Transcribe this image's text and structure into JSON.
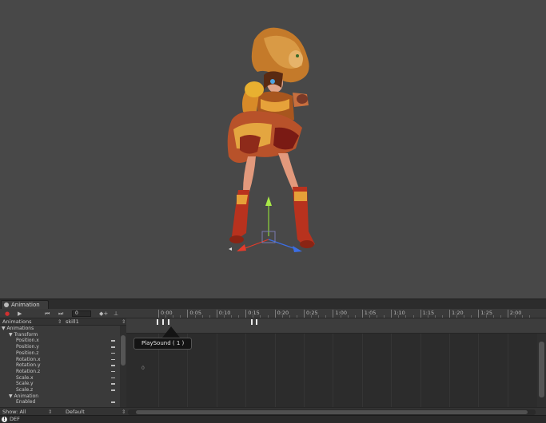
{
  "animation_window": {
    "tab_label": "Animation",
    "frame_value": "0",
    "clip_header_label": "Animations",
    "clip_name": "skill1",
    "timeline_labels": [
      "0:00",
      "0:05",
      "0:10",
      "0:15",
      "0:20",
      "0:25",
      "1:00",
      "1:05",
      "1:10",
      "1:15",
      "1:20",
      "1:25",
      "2:00"
    ],
    "properties": [
      {
        "label": "Animations",
        "indent": 0,
        "arrow": "▼"
      },
      {
        "label": "Transform",
        "indent": 1,
        "arrow": "▼"
      },
      {
        "label": "Position.x",
        "indent": 2
      },
      {
        "label": "Position.y",
        "indent": 2
      },
      {
        "label": "Position.z",
        "indent": 2
      },
      {
        "label": "Rotation.x",
        "indent": 2
      },
      {
        "label": "Rotation.y",
        "indent": 2
      },
      {
        "label": "Rotation.z",
        "indent": 2
      },
      {
        "label": "Scale.x",
        "indent": 2
      },
      {
        "label": "Scale.y",
        "indent": 2
      },
      {
        "label": "Scale.z",
        "indent": 2
      },
      {
        "label": "Animation",
        "indent": 1,
        "arrow": "▼"
      },
      {
        "label": "Enabled",
        "indent": 2
      }
    ],
    "tooltip": "PlaySound ( 1 )",
    "curve_value_label": "0",
    "show_label": "Show: All",
    "mode_label": "Default"
  },
  "status_bar": {
    "icon": "info-icon",
    "message": "DEF"
  },
  "colors": {
    "viewport_bg": "#484848",
    "panel_bg": "#383838",
    "gizmo_y": "#8fd53a",
    "gizmo_x": "#e53b2b",
    "gizmo_z": "#3b6ee5"
  }
}
